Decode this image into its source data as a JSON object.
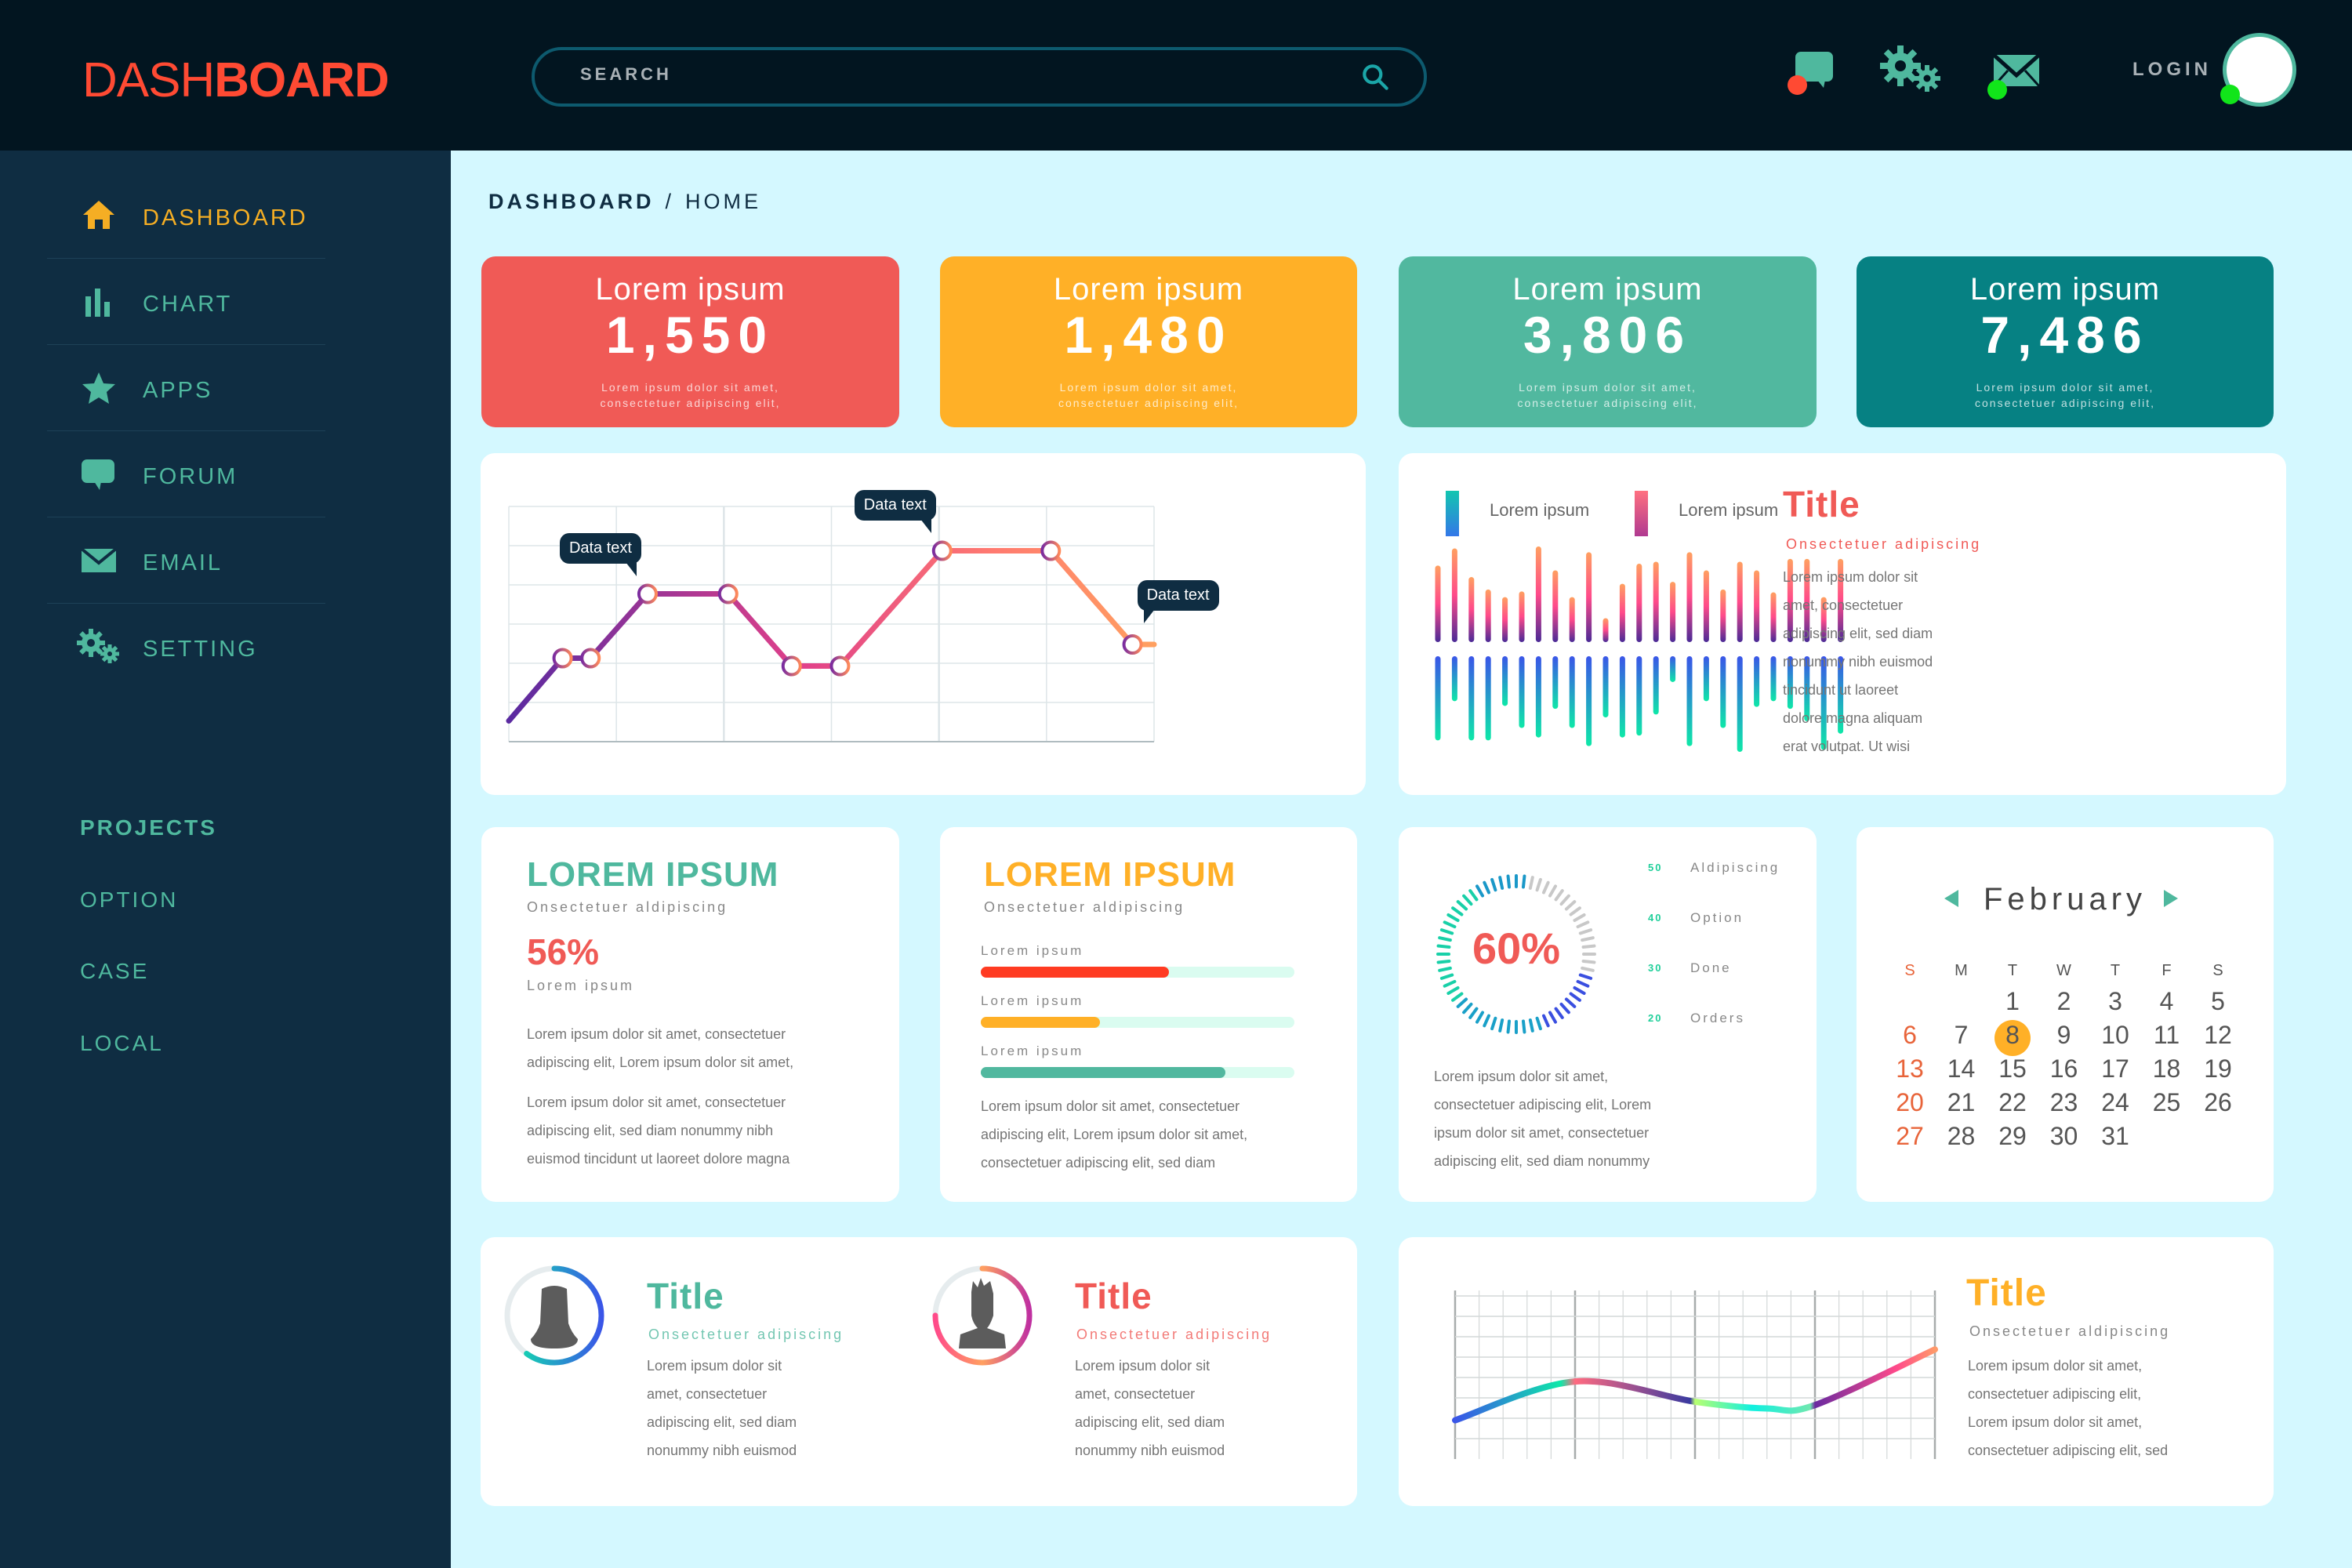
{
  "header": {
    "logo_light": "DASH",
    "logo_bold": "BOARD",
    "search_placeholder": "SEARCH",
    "icons": [
      "chat-icon",
      "gear-icon",
      "mail-icon"
    ],
    "badges": {
      "chat": "#ff4a33",
      "mail": "#11e51a",
      "avatar": "#11e51a"
    },
    "login_label": "LOGIN"
  },
  "sidebar": {
    "items": [
      {
        "label": "DASHBOARD",
        "icon": "home-icon",
        "active": true
      },
      {
        "label": "CHART",
        "icon": "bar-chart-icon"
      },
      {
        "label": "APPS",
        "icon": "star-icon"
      },
      {
        "label": "FORUM",
        "icon": "chat-icon"
      },
      {
        "label": "EMAIL",
        "icon": "mail-icon"
      },
      {
        "label": "SETTING",
        "icon": "gear-icon"
      }
    ],
    "projects_title": "PROJECTS",
    "projects": [
      "OPTION",
      "CASE",
      "LOCAL"
    ]
  },
  "breadcrumb": {
    "root": "DASHBOARD",
    "separator": "/",
    "current": "HOME"
  },
  "stats": [
    {
      "title": "Lorem ipsum",
      "value": "1,550",
      "desc1": "Lorem ipsum dolor sit amet,",
      "desc2": "consectetuer adipiscing elit,",
      "color": "#f05a56"
    },
    {
      "title": "Lorem ipsum",
      "value": "1,480",
      "desc1": "Lorem ipsum dolor sit amet,",
      "desc2": "consectetuer adipiscing elit,",
      "color": "#ffb027"
    },
    {
      "title": "Lorem ipsum",
      "value": "3,806",
      "desc1": "Lorem ipsum dolor sit amet,",
      "desc2": "consectetuer adipiscing elit,",
      "color": "#51b89f"
    },
    {
      "title": "Lorem ipsum",
      "value": "7,486",
      "desc1": "Lorem ipsum dolor sit amet,",
      "desc2": "consectetuer adipiscing elit,",
      "color": "#068183"
    }
  ],
  "chart_data": [
    {
      "type": "line",
      "title": "",
      "grid": true,
      "xlim": [
        0,
        6
      ],
      "ylim": [
        0,
        6
      ],
      "x": [
        0,
        0.5,
        0.76,
        1.29,
        2.04,
        2.63,
        3.08,
        4.03,
        5.04,
        5.8,
        6.0
      ],
      "y": [
        0.53,
        2.13,
        2.13,
        3.77,
        3.77,
        1.93,
        1.93,
        4.87,
        4.87,
        2.48,
        2.48
      ],
      "markers": [
        false,
        true,
        true,
        true,
        true,
        true,
        true,
        true,
        true,
        true,
        false
      ],
      "annotations": [
        {
          "label": "Data text",
          "point_index": 3
        },
        {
          "label": "Data text",
          "point_index": 7
        },
        {
          "label": "Data text",
          "point_index": 9
        }
      ]
    },
    {
      "type": "bar",
      "title": "",
      "legend": [
        "Lorem ipsum",
        "Lorem ipsum"
      ],
      "legend_placement": "top-left",
      "series": [
        {
          "name": "Lorem ipsum",
          "direction": "up",
          "values": [
            80,
            98,
            68,
            55,
            47,
            53,
            100,
            75,
            47,
            94,
            25,
            61,
            82,
            84,
            63,
            94,
            75,
            55,
            84,
            75,
            52,
            87,
            87,
            47,
            87
          ]
        },
        {
          "name": "Lorem ipsum",
          "direction": "down",
          "values": [
            88,
            47,
            88,
            88,
            52,
            75,
            85,
            55,
            75,
            94,
            64,
            85,
            83,
            61,
            27,
            94,
            47,
            75,
            100,
            53,
            47,
            55,
            68,
            98,
            81
          ]
        }
      ]
    },
    {
      "type": "line",
      "title": "",
      "grid": true,
      "xlim": [
        0,
        4
      ],
      "ylim": [
        0,
        100
      ],
      "x": [
        0,
        1,
        2,
        2.6,
        3,
        4
      ],
      "y": [
        23,
        46,
        34,
        30,
        32,
        65
      ]
    }
  ],
  "wave_panel": {
    "title": "Title",
    "subtitle": "Onsectetuer adipiscing",
    "lines": [
      "Lorem ipsum dolor sit",
      "amet, consectetuer",
      "adipiscing elit, sed diam",
      "nonummy nibh euismod",
      "tincidunt ut laoreet",
      "dolore magna aliquam",
      "erat volutpat. Ut wisi"
    ]
  },
  "card_percent": {
    "title": "LOREM IPSUM",
    "subtitle": "Onsectetuer aldipiscing",
    "value": "56%",
    "label": "Lorem ipsum",
    "para1": [
      "Lorem ipsum dolor sit amet, consectetuer",
      "adipiscing elit, Lorem ipsum dolor sit amet,"
    ],
    "para2": [
      "Lorem ipsum dolor sit amet, consectetuer",
      "adipiscing elit, sed diam nonummy nibh",
      "euismod tincidunt ut laoreet dolore magna"
    ]
  },
  "card_progress": {
    "title": "LOREM IPSUM",
    "subtitle": "Onsectetuer aldipiscing",
    "bars": [
      {
        "label": "Lorem ipsum",
        "percent": 60,
        "color": "#ff3b22"
      },
      {
        "label": "Lorem ipsum",
        "percent": 38,
        "color": "#ffb027"
      },
      {
        "label": "Lorem ipsum",
        "percent": 78,
        "color": "#51b89f"
      }
    ],
    "lines": [
      "Lorem ipsum dolor sit amet, consectetuer",
      "adipiscing elit, Lorem ipsum dolor sit amet,",
      "consectetuer adipiscing elit, sed diam"
    ]
  },
  "card_gauge": {
    "value": "60%",
    "percent": 60,
    "legend": [
      {
        "num": "50",
        "label": "Aldipiscing"
      },
      {
        "num": "40",
        "label": "Option"
      },
      {
        "num": "30",
        "label": "Done"
      },
      {
        "num": "20",
        "label": "Orders"
      }
    ],
    "lines": [
      "Lorem ipsum dolor sit amet,",
      "consectetuer adipiscing elit, Lorem",
      "ipsum dolor sit amet, consectetuer",
      "adipiscing elit, sed diam nonummy"
    ]
  },
  "calendar": {
    "month": "February",
    "weekdays": [
      "S",
      "M",
      "T",
      "W",
      "T",
      "F",
      "S"
    ],
    "start_offset": 2,
    "days": 31,
    "selected": 8,
    "selected_color": "#ffb027",
    "sunday_color": "#e8643a"
  },
  "profiles": [
    {
      "title": "Title",
      "subtitle": "Onsectetuer adipiscing",
      "lines": [
        "Lorem ipsum dolor sit",
        "amet, consectetuer",
        "adipiscing elit, sed diam",
        "nonummy nibh euismod"
      ],
      "avatar": "female-avatar-icon",
      "ring_percent": 60,
      "color": "#4fb89e"
    },
    {
      "title": "Title",
      "subtitle": "Onsectetuer adipiscing",
      "lines": [
        "Lorem ipsum dolor sit",
        "amet, consectetuer",
        "adipiscing elit, sed diam",
        "nonummy nibh euismod"
      ],
      "avatar": "male-avatar-icon",
      "ring_percent": 75,
      "color": "#f05a56"
    }
  ],
  "wave_card": {
    "title": "Title",
    "subtitle": "Onsectetuer aldipiscing",
    "lines": [
      "Lorem ipsum dolor sit amet,",
      "consectetuer adipiscing elit,",
      "Lorem ipsum dolor sit amet,",
      "consectetuer adipiscing elit, sed"
    ]
  }
}
